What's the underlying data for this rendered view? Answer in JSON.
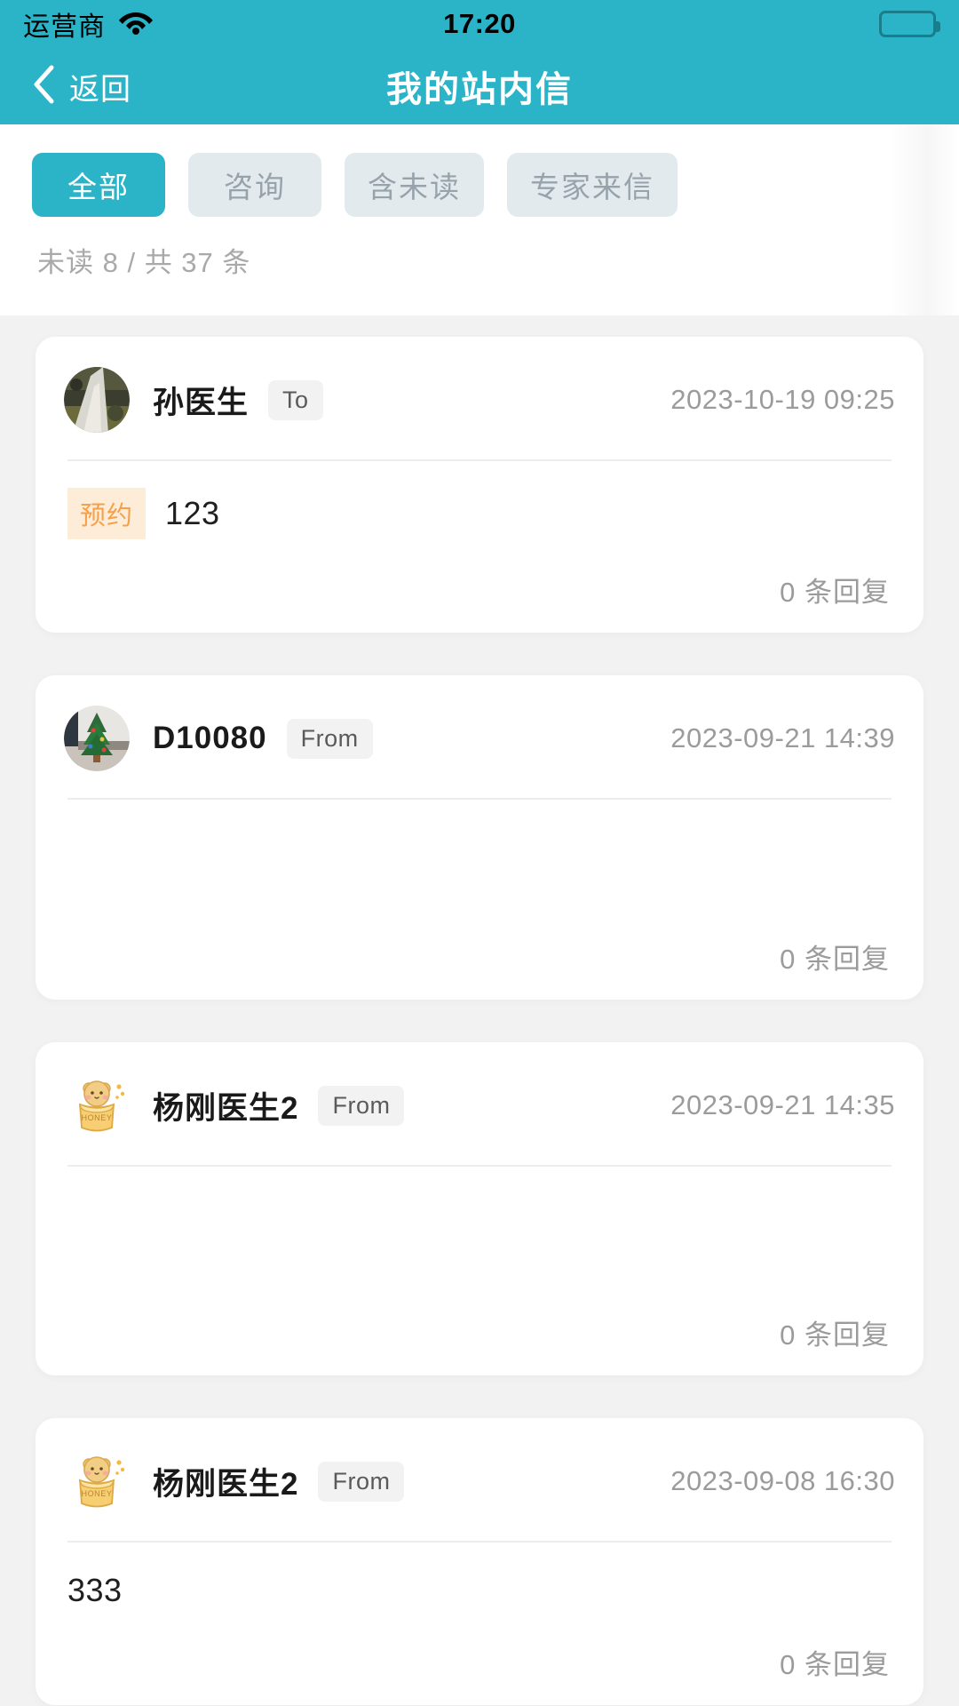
{
  "status_bar": {
    "carrier": "运营商",
    "wifi_icon": "wifi-icon",
    "time": "17:20",
    "battery_icon": "battery-full-icon"
  },
  "nav": {
    "back_icon": "chevron-left-icon",
    "back_label": "返回",
    "title": "我的站内信"
  },
  "filters": {
    "chips": [
      {
        "label": "全部",
        "active": true
      },
      {
        "label": "咨询",
        "active": false
      },
      {
        "label": "含未读",
        "active": false
      },
      {
        "label": "专家来信",
        "active": false
      }
    ]
  },
  "summary": {
    "text": "未读 8 / 共 37 条",
    "unread": 8,
    "total": 37
  },
  "messages": [
    {
      "avatar_icon": "avatar-photo-nature",
      "sender": "孙医生",
      "direction": "To",
      "date": "2023-10-19 09:25",
      "category_tag": "预约",
      "body": "123",
      "replies": "0 条回复"
    },
    {
      "avatar_icon": "avatar-photo-christmas-tree",
      "sender": "D10080",
      "direction": "From",
      "date": "2023-09-21 14:39",
      "category_tag": "",
      "body": "",
      "replies": "0 条回复"
    },
    {
      "avatar_icon": "avatar-bear-honey-jar",
      "sender": "杨刚医生2",
      "direction": "From",
      "date": "2023-09-21 14:35",
      "category_tag": "",
      "body": "",
      "replies": "0 条回复"
    },
    {
      "avatar_icon": "avatar-bear-honey-jar",
      "sender": "杨刚医生2",
      "direction": "From",
      "date": "2023-09-08 16:30",
      "category_tag": "",
      "body": "333",
      "replies": "0 条回复"
    }
  ],
  "colors": {
    "accent": "#2bb4c8",
    "chip_inactive_bg": "#e3eaee",
    "chip_inactive_text": "#97a3ab",
    "tag_bg": "#fdecd8",
    "tag_text": "#f5a04a",
    "page_bg": "#f2f2f2",
    "card_bg": "#ffffff",
    "muted_text": "#9b9b9b"
  }
}
